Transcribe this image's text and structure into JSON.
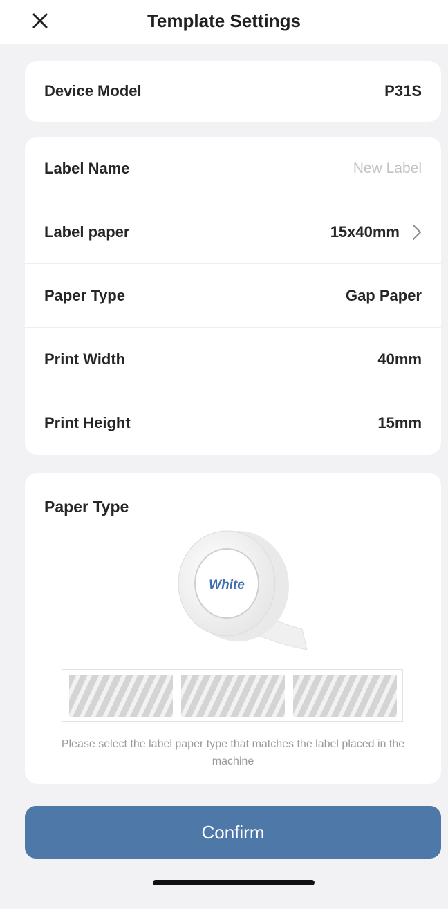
{
  "header": {
    "title": "Template Settings"
  },
  "device": {
    "label": "Device Model",
    "value": "P31S"
  },
  "settings": {
    "label_name": {
      "label": "Label Name",
      "placeholder": "New Label"
    },
    "label_paper": {
      "label": "Label paper",
      "value": "15x40mm"
    },
    "paper_type": {
      "label": "Paper Type",
      "value": "Gap Paper"
    },
    "print_width": {
      "label": "Print Width",
      "value": "40mm"
    },
    "print_height": {
      "label": "Print Height",
      "value": "15mm"
    }
  },
  "paper_section": {
    "title": "Paper Type",
    "roll_label": "White",
    "hint": "Please select the label paper type that matches the label placed in the machine"
  },
  "confirm_label": "Confirm",
  "colors": {
    "accent": "#4d78a8",
    "background": "#f2f2f4",
    "card": "#ffffff"
  }
}
